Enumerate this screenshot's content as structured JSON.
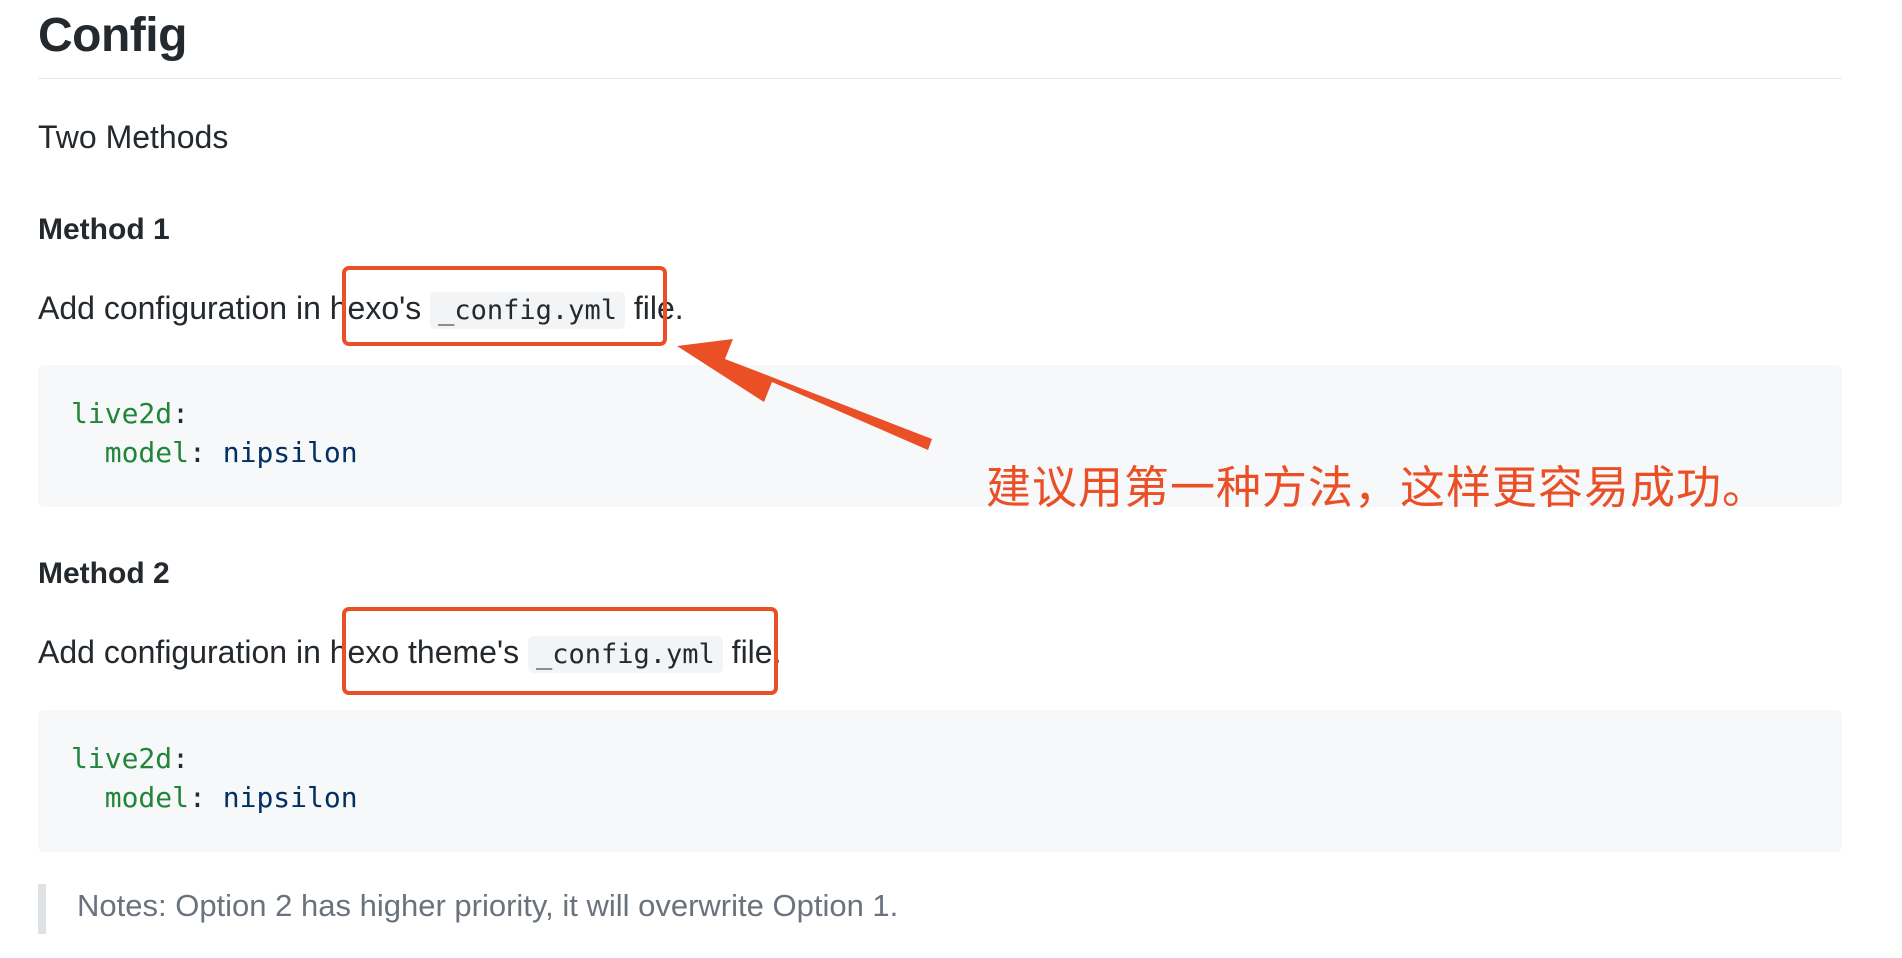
{
  "heading": "Config",
  "intro": "Two Methods",
  "method1": {
    "title": "Method 1",
    "text_before": "Add configuration in ",
    "text_subject": "hexo's ",
    "code": "_config.yml",
    "text_after": " file.",
    "code_block": {
      "line1_key": "live2d",
      "line1_punct": ":",
      "line2_indent": "  ",
      "line2_key": "model",
      "line2_punct": ": ",
      "line2_value": "nipsilon"
    }
  },
  "method2": {
    "title": "Method 2",
    "text_before": "Add configuration in ",
    "text_subject": "hexo theme's ",
    "code": "_config.yml",
    "text_after": " file.",
    "code_block": {
      "line1_key": "live2d",
      "line1_punct": ":",
      "line2_indent": "  ",
      "line2_key": "model",
      "line2_punct": ": ",
      "line2_value": "nipsilon"
    }
  },
  "notes": "Notes: Option 2 has higher priority, it will overwrite Option 1.",
  "annotation": {
    "text": "建议用第一种方法，这样更容易成功。",
    "color": "#ea4f26"
  },
  "colors": {
    "yaml_key": "#22863a",
    "yaml_value": "#032f62",
    "code_bg": "#f6f8fa",
    "quote_text": "#6a737d"
  }
}
